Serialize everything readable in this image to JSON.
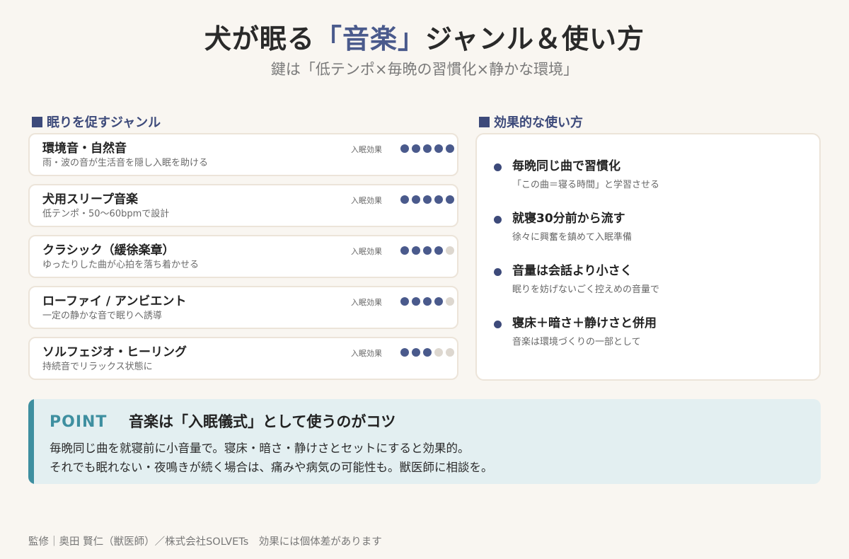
{
  "header": {
    "title_pre": "犬が眠る",
    "title_accent": "「音楽」",
    "title_post": "ジャンル＆使い方",
    "subtitle": "鍵は「低テンポ×毎晩の習慣化×静かな環境」"
  },
  "colors": {
    "background": "#f9f6f1",
    "accent": "#4a5a8c",
    "point_teal": "#3e8fa0",
    "dot_off": "#ddd7cf"
  },
  "genres": {
    "heading": "眠りを促すジャンル",
    "effect_label": "入眠効果",
    "max_rating": 5,
    "items": [
      {
        "name": "環境音・自然音",
        "desc": "雨・波の音が生活音を隠し入眠を助ける",
        "rating": 5
      },
      {
        "name": "犬用スリープ音楽",
        "desc": "低テンポ・50〜60bpmで設計",
        "rating": 5
      },
      {
        "name": "クラシック（緩徐楽章）",
        "desc": "ゆったりした曲が心拍を落ち着かせる",
        "rating": 4
      },
      {
        "name": "ローファイ / アンビエント",
        "desc": "一定の静かな音で眠りへ誘導",
        "rating": 4
      },
      {
        "name": "ソルフェジオ・ヒーリング",
        "desc": "持続音でリラックス状態に",
        "rating": 3
      }
    ]
  },
  "usage": {
    "heading": "効果的な使い方",
    "items": [
      {
        "title": "毎晩同じ曲で習慣化",
        "desc": "「この曲＝寝る時間」と学習させる"
      },
      {
        "title": "就寝30分前から流す",
        "desc": "徐々に興奮を鎮めて入眠準備"
      },
      {
        "title": "音量は会話より小さく",
        "desc": "眠りを妨げないごく控えめの音量で"
      },
      {
        "title": "寝床＋暗さ＋静けさと併用",
        "desc": "音楽は環境づくりの一部として"
      }
    ]
  },
  "point": {
    "label": "POINT",
    "title": "音楽は「入眠儀式」として使うのがコツ",
    "line1": "毎晩同じ曲を就寝前に小音量で。寝床・暗さ・静けさとセットにすると効果的。",
    "line2": "それでも眠れない・夜鳴きが続く場合は、痛みや病気の可能性も。獣医師に相談を。"
  },
  "footer": {
    "text": "監修｜奥田 賢仁（獣医師）／株式会社SOLVETs　効果には個体差があります"
  }
}
